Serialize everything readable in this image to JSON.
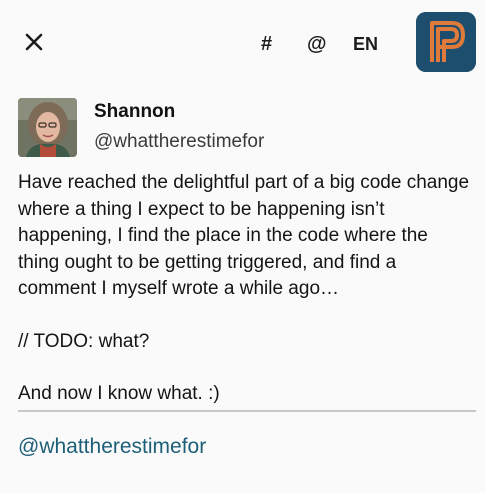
{
  "toolbar": {
    "hashtag_label": "#",
    "mention_label": "@",
    "language_label": "EN",
    "close_icon": "close-icon",
    "app_logo_icon": "app-logo-icon"
  },
  "colors": {
    "logo_background": "#1d4e6e",
    "logo_accent": "#e07a3a",
    "link": "#1d5f78",
    "divider": "#c7c7c7"
  },
  "post": {
    "author_name": "Shannon",
    "author_handle": "@whattherestimefor",
    "paragraphs": [
      "Have reached the delightful part of a big code change where a thing I expect to be happening isn’t happening, I find the place in the code where the thing ought to be getting triggered, and find a comment I myself wrote a while ago…",
      "// TODO: what?",
      "And now I know what.  :)"
    ]
  },
  "reply": {
    "mention_text": "@whattherestimefor"
  }
}
